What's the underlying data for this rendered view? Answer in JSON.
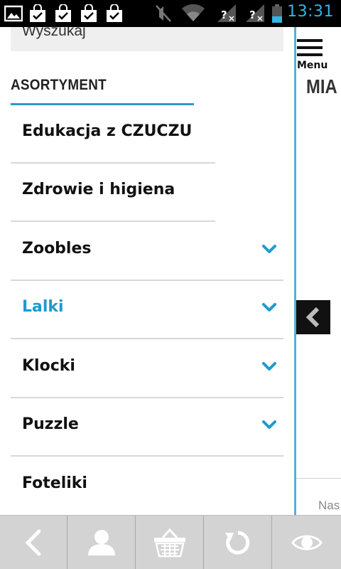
{
  "status_bar": {
    "time": "13:31",
    "icons": [
      "gallery-icon",
      "shopping-bag-check-icon",
      "shopping-bag-check-icon",
      "shopping-bag-check-icon",
      "shopping-bag-check-icon",
      "muted-icon",
      "wifi-icon",
      "no-signal-icon",
      "no-signal-icon",
      "battery-icon"
    ]
  },
  "drawer": {
    "search_placeholder": "Wyszukaj",
    "section_title": "ASORTYMENT",
    "items": [
      {
        "label": "Edukacja z CZUCZU",
        "expandable": false,
        "active": false
      },
      {
        "label": "Zdrowie i higiena",
        "expandable": false,
        "active": false
      },
      {
        "label": "Zoobles",
        "expandable": true,
        "active": false
      },
      {
        "label": "Lalki",
        "expandable": true,
        "active": true
      },
      {
        "label": "Klocki",
        "expandable": true,
        "active": false
      },
      {
        "label": "Puzzle",
        "expandable": true,
        "active": false
      },
      {
        "label": "Foteliki",
        "expandable": false,
        "active": false
      }
    ]
  },
  "right_panel": {
    "menu_label": "Menu",
    "heading_partial": "MIA",
    "footer_partial": "Nas"
  },
  "bottom_bar": {
    "buttons": [
      "back-icon",
      "user-icon",
      "basket-icon",
      "refresh-icon",
      "eye-icon"
    ]
  },
  "colors": {
    "accent": "#1e9ad0",
    "status_time": "#33b5e5",
    "bottom_bar": "#d3d3d3"
  }
}
